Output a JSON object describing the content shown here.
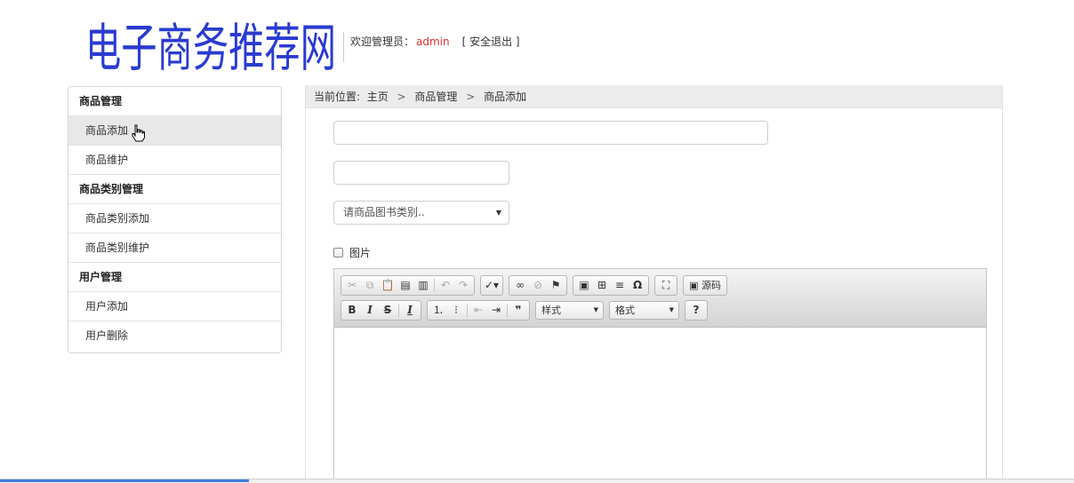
{
  "header": {
    "logo_text": "电子商务推荐网",
    "welcome_label": "欢迎管理员：",
    "username": "admin",
    "logout_label": "[ 安全退出 ]"
  },
  "sidebar": {
    "groups": [
      {
        "title": "商品管理",
        "items": [
          {
            "label": "商品添加",
            "active": true
          },
          {
            "label": "商品维护"
          }
        ]
      },
      {
        "title": "商品类别管理",
        "items": [
          {
            "label": "商品类别添加"
          },
          {
            "label": "商品类别维护"
          }
        ]
      },
      {
        "title": "用户管理",
        "items": [
          {
            "label": "用户添加"
          },
          {
            "label": "用户删除"
          }
        ]
      }
    ]
  },
  "breadcrumb": {
    "prefix": "当前位置:",
    "home": "主页",
    "section": "商品管理",
    "page": "商品添加",
    "separator": ">"
  },
  "form": {
    "name_value": "",
    "price_value": "",
    "category_select": "请商品图书类别..",
    "image_checkbox_label": "图片"
  },
  "editor": {
    "source_label": "源码",
    "style_combo": "样式",
    "format_combo": "格式",
    "help_label": "?"
  },
  "colors": {
    "username": "#d9302c",
    "logo": "#2a3bd1",
    "progress": "#3b7ddd"
  }
}
